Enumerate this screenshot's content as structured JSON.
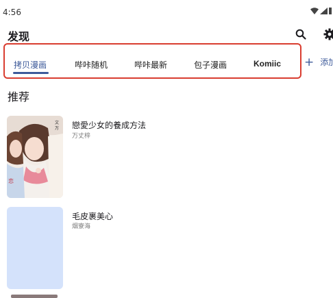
{
  "status_bar": {
    "time": "4:56"
  },
  "app_bar": {
    "title": "发现",
    "icons": [
      "search-icon",
      "settings-icon"
    ]
  },
  "tabs": [
    {
      "label": "拷贝漫画",
      "active": true
    },
    {
      "label": "哔咔随机",
      "active": false
    },
    {
      "label": "哔咔最新",
      "active": false
    },
    {
      "label": "包子漫画",
      "active": false
    },
    {
      "label": "Komiic",
      "active": false
    }
  ],
  "add_tab": {
    "label": "添加"
  },
  "section": {
    "title": "推荐"
  },
  "comics": [
    {
      "title": "戀愛少女的養成方法",
      "author": "万丈梓"
    },
    {
      "title": "毛皮裹美心",
      "author": "烟寮海"
    }
  ],
  "colors": {
    "accent": "#3d5a9a",
    "highlight_box": "#d93c2f",
    "placeholder_cover": "#d4e2fb"
  }
}
